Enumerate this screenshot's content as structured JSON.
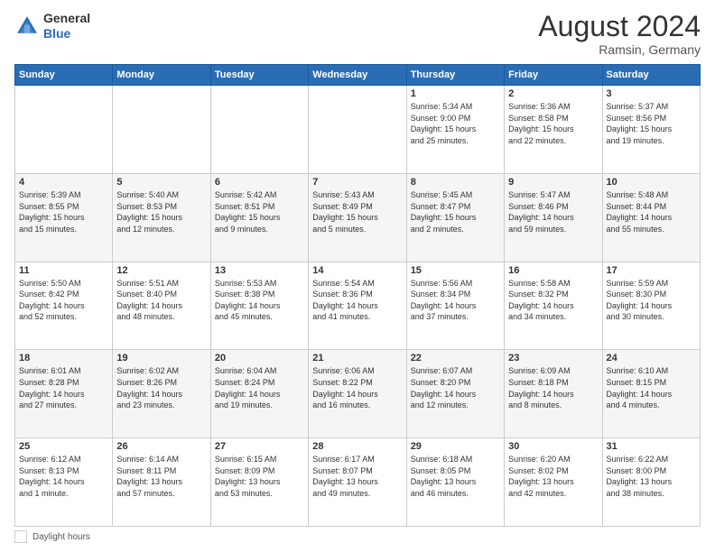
{
  "header": {
    "logo_line1": "General",
    "logo_line2": "Blue",
    "month_year": "August 2024",
    "location": "Ramsin, Germany"
  },
  "days_of_week": [
    "Sunday",
    "Monday",
    "Tuesday",
    "Wednesday",
    "Thursday",
    "Friday",
    "Saturday"
  ],
  "footer": {
    "label": "Daylight hours"
  },
  "weeks": [
    [
      {
        "day": "",
        "info": ""
      },
      {
        "day": "",
        "info": ""
      },
      {
        "day": "",
        "info": ""
      },
      {
        "day": "",
        "info": ""
      },
      {
        "day": "1",
        "info": "Sunrise: 5:34 AM\nSunset: 9:00 PM\nDaylight: 15 hours\nand 25 minutes."
      },
      {
        "day": "2",
        "info": "Sunrise: 5:36 AM\nSunset: 8:58 PM\nDaylight: 15 hours\nand 22 minutes."
      },
      {
        "day": "3",
        "info": "Sunrise: 5:37 AM\nSunset: 8:56 PM\nDaylight: 15 hours\nand 19 minutes."
      }
    ],
    [
      {
        "day": "4",
        "info": "Sunrise: 5:39 AM\nSunset: 8:55 PM\nDaylight: 15 hours\nand 15 minutes."
      },
      {
        "day": "5",
        "info": "Sunrise: 5:40 AM\nSunset: 8:53 PM\nDaylight: 15 hours\nand 12 minutes."
      },
      {
        "day": "6",
        "info": "Sunrise: 5:42 AM\nSunset: 8:51 PM\nDaylight: 15 hours\nand 9 minutes."
      },
      {
        "day": "7",
        "info": "Sunrise: 5:43 AM\nSunset: 8:49 PM\nDaylight: 15 hours\nand 5 minutes."
      },
      {
        "day": "8",
        "info": "Sunrise: 5:45 AM\nSunset: 8:47 PM\nDaylight: 15 hours\nand 2 minutes."
      },
      {
        "day": "9",
        "info": "Sunrise: 5:47 AM\nSunset: 8:46 PM\nDaylight: 14 hours\nand 59 minutes."
      },
      {
        "day": "10",
        "info": "Sunrise: 5:48 AM\nSunset: 8:44 PM\nDaylight: 14 hours\nand 55 minutes."
      }
    ],
    [
      {
        "day": "11",
        "info": "Sunrise: 5:50 AM\nSunset: 8:42 PM\nDaylight: 14 hours\nand 52 minutes."
      },
      {
        "day": "12",
        "info": "Sunrise: 5:51 AM\nSunset: 8:40 PM\nDaylight: 14 hours\nand 48 minutes."
      },
      {
        "day": "13",
        "info": "Sunrise: 5:53 AM\nSunset: 8:38 PM\nDaylight: 14 hours\nand 45 minutes."
      },
      {
        "day": "14",
        "info": "Sunrise: 5:54 AM\nSunset: 8:36 PM\nDaylight: 14 hours\nand 41 minutes."
      },
      {
        "day": "15",
        "info": "Sunrise: 5:56 AM\nSunset: 8:34 PM\nDaylight: 14 hours\nand 37 minutes."
      },
      {
        "day": "16",
        "info": "Sunrise: 5:58 AM\nSunset: 8:32 PM\nDaylight: 14 hours\nand 34 minutes."
      },
      {
        "day": "17",
        "info": "Sunrise: 5:59 AM\nSunset: 8:30 PM\nDaylight: 14 hours\nand 30 minutes."
      }
    ],
    [
      {
        "day": "18",
        "info": "Sunrise: 6:01 AM\nSunset: 8:28 PM\nDaylight: 14 hours\nand 27 minutes."
      },
      {
        "day": "19",
        "info": "Sunrise: 6:02 AM\nSunset: 8:26 PM\nDaylight: 14 hours\nand 23 minutes."
      },
      {
        "day": "20",
        "info": "Sunrise: 6:04 AM\nSunset: 8:24 PM\nDaylight: 14 hours\nand 19 minutes."
      },
      {
        "day": "21",
        "info": "Sunrise: 6:06 AM\nSunset: 8:22 PM\nDaylight: 14 hours\nand 16 minutes."
      },
      {
        "day": "22",
        "info": "Sunrise: 6:07 AM\nSunset: 8:20 PM\nDaylight: 14 hours\nand 12 minutes."
      },
      {
        "day": "23",
        "info": "Sunrise: 6:09 AM\nSunset: 8:18 PM\nDaylight: 14 hours\nand 8 minutes."
      },
      {
        "day": "24",
        "info": "Sunrise: 6:10 AM\nSunset: 8:15 PM\nDaylight: 14 hours\nand 4 minutes."
      }
    ],
    [
      {
        "day": "25",
        "info": "Sunrise: 6:12 AM\nSunset: 8:13 PM\nDaylight: 14 hours\nand 1 minute."
      },
      {
        "day": "26",
        "info": "Sunrise: 6:14 AM\nSunset: 8:11 PM\nDaylight: 13 hours\nand 57 minutes."
      },
      {
        "day": "27",
        "info": "Sunrise: 6:15 AM\nSunset: 8:09 PM\nDaylight: 13 hours\nand 53 minutes."
      },
      {
        "day": "28",
        "info": "Sunrise: 6:17 AM\nSunset: 8:07 PM\nDaylight: 13 hours\nand 49 minutes."
      },
      {
        "day": "29",
        "info": "Sunrise: 6:18 AM\nSunset: 8:05 PM\nDaylight: 13 hours\nand 46 minutes."
      },
      {
        "day": "30",
        "info": "Sunrise: 6:20 AM\nSunset: 8:02 PM\nDaylight: 13 hours\nand 42 minutes."
      },
      {
        "day": "31",
        "info": "Sunrise: 6:22 AM\nSunset: 8:00 PM\nDaylight: 13 hours\nand 38 minutes."
      }
    ]
  ]
}
